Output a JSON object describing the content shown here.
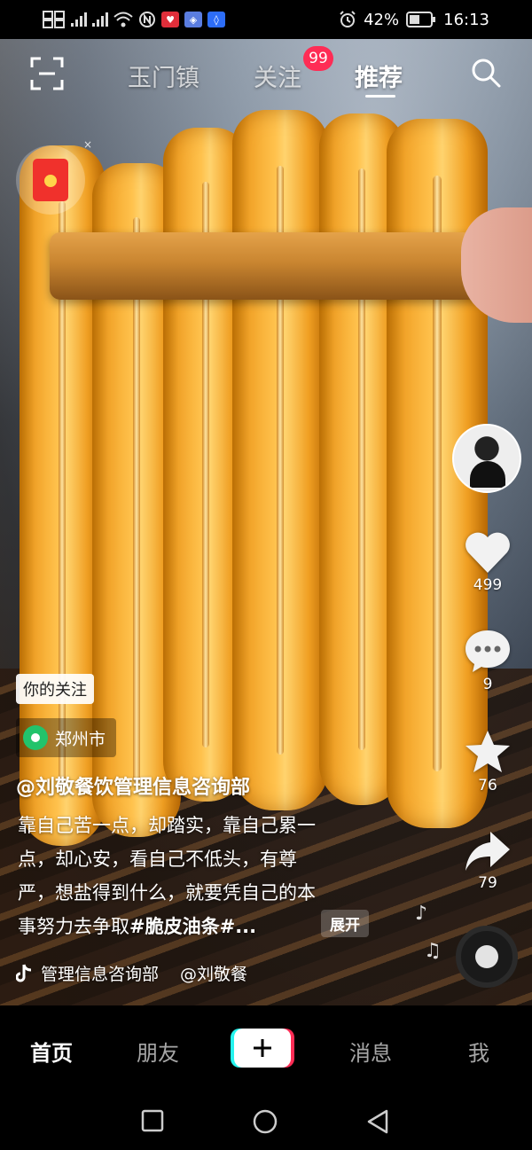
{
  "status_bar": {
    "left_icons": [
      "sim-signal-icon",
      "signal-bars-icon",
      "signal-bars-icon",
      "wifi-icon",
      "nfc-icon",
      "notification-badge-icon",
      "app-notification-icon",
      "shield-icon"
    ],
    "battery": "42%",
    "time": "16:13"
  },
  "top_nav": {
    "tabs": [
      {
        "label": "玉门镇",
        "active": false
      },
      {
        "label": "关注",
        "active": false
      },
      {
        "label": "推荐",
        "active": true
      }
    ],
    "follow_badge": "99"
  },
  "rail": {
    "likes": "499",
    "comments": "9",
    "favorites": "76",
    "shares": "79"
  },
  "caption": {
    "follow_tag": "你的关注",
    "location": "郑州市",
    "author": "@刘敬餐饮管理信息咨询部",
    "lines": [
      "靠自己苦一点，却踏实，靠自己累一",
      "点，却心安，看自己不低头，有尊",
      "严，想盐得到什么，就要凭自己的本"
    ],
    "last_line_text": "事努力去争取",
    "hashtag": "#脆皮油条#...",
    "expand_label": "展开",
    "music": "管理信息咨询部",
    "music_author": "@刘敬餐"
  },
  "tab_bar": {
    "items": [
      {
        "label": "首页",
        "active": true
      },
      {
        "label": "朋友",
        "active": false
      },
      {
        "label": "消息",
        "active": false
      },
      {
        "label": "我",
        "active": false
      }
    ]
  },
  "colors": {
    "accent_red": "#fe2c55",
    "accent_cyan": "#25f4ee",
    "location_green": "#22c36b"
  }
}
